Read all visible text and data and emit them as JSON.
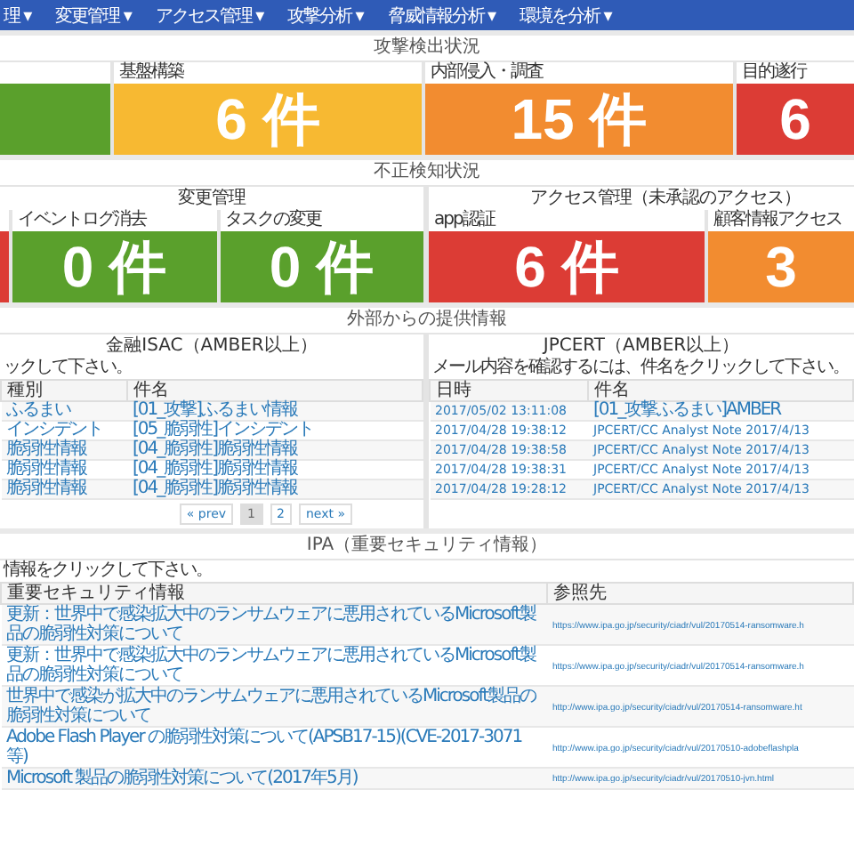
{
  "nav": [
    {
      "label": "理 ▾"
    },
    {
      "label": "変更管理 ▾"
    },
    {
      "label": "アクセス管理 ▾"
    },
    {
      "label": "攻撃分析 ▾"
    },
    {
      "label": "脅威情報分析 ▾"
    },
    {
      "label": "環境を分析 ▾"
    }
  ],
  "attack": {
    "title": "攻撃検出状況",
    "cards": [
      {
        "color": "#5aa02c"
      },
      {
        "label": "基盤構築",
        "value": "6 件",
        "color": "#f7b932"
      },
      {
        "label": "内部侵入・調査",
        "value": "15 件",
        "color": "#f28c30"
      },
      {
        "label": "目的遂行",
        "value": "6",
        "color": "#dc3c35"
      }
    ]
  },
  "fraud": {
    "title": "不正検知状況",
    "groups": [
      {
        "title": "変更管理",
        "cards": [
          {
            "color": "#dc3c35"
          },
          {
            "label": "イベントログ消去",
            "value": "0 件",
            "color": "#5aa02c"
          },
          {
            "label": "タスクの変更",
            "value": "0 件",
            "color": "#5aa02c"
          }
        ]
      },
      {
        "title": "アクセス管理（未承認のアクセス）",
        "cards": [
          {
            "label": "app認証",
            "value": "6 件",
            "color": "#dc3c35"
          },
          {
            "label": "顧客情報アクセス",
            "value": "3",
            "color": "#f28c30"
          }
        ]
      }
    ]
  },
  "external": {
    "title": "外部からの提供情報",
    "panels": [
      {
        "title": "金融ISAC（AMBER以上）",
        "instruction": "ックして下さい。",
        "columns": [
          "種別",
          "件名"
        ],
        "rows": [
          [
            "ふるまい",
            "[01_攻撃]ふるまい情報"
          ],
          [
            "インシデント",
            "[05_脆弱性]インシデント"
          ],
          [
            "脆弱性情報",
            "[04_脆弱性]脆弱性情報"
          ],
          [
            "脆弱性情報",
            "[04_脆弱性]脆弱性情報"
          ],
          [
            "脆弱性情報",
            "[04_脆弱性]脆弱性情報"
          ]
        ],
        "pager": [
          {
            "label": "« prev",
            "selected": false
          },
          {
            "label": "1",
            "selected": true
          },
          {
            "label": "2",
            "selected": false
          },
          {
            "label": "next »",
            "selected": false
          }
        ]
      },
      {
        "title": "JPCERT（AMBER以上）",
        "instruction": "メール内容を確認するには、件名をクリックして下さい。",
        "columns": [
          "日時",
          "件名"
        ],
        "rows": [
          [
            "2017/05/02 13:11:08",
            "[01_攻撃ふるまい]AMBER"
          ],
          [
            "2017/04/28 19:38:12",
            "JPCERT/CC Analyst Note 2017/4/13"
          ],
          [
            "2017/04/28 19:38:58",
            "JPCERT/CC Analyst Note 2017/4/13"
          ],
          [
            "2017/04/28 19:38:31",
            "JPCERT/CC Analyst Note 2017/4/13"
          ],
          [
            "2017/04/28 19:28:12",
            "JPCERT/CC Analyst Note 2017/4/13"
          ]
        ]
      }
    ]
  },
  "ipa": {
    "title": "IPA（重要セキュリティ情報）",
    "instruction": "情報をクリックして下さい。",
    "columns": [
      "重要セキュリティ情報",
      "参照先"
    ],
    "rows": [
      [
        "更新：世界中で感染拡大中のランサムウェアに悪用されているMicrosoft製品の脆弱性対策について",
        "https://www.ipa.go.jp/security/ciadr/vul/20170514-ransomware.h"
      ],
      [
        "更新：世界中で感染拡大中のランサムウェアに悪用されているMicrosoft製品の脆弱性対策について",
        "https://www.ipa.go.jp/security/ciadr/vul/20170514-ransomware.h"
      ],
      [
        "世界中で感染が拡大中のランサムウェアに悪用されているMicrosoft製品の脆弱性対策について",
        "http://www.ipa.go.jp/security/ciadr/vul/20170514-ransomware.ht"
      ],
      [
        "Adobe Flash Player の脆弱性対策について(APSB17-15)(CVE-2017-3071等)",
        "http://www.ipa.go.jp/security/ciadr/vul/20170510-adobeflashpla"
      ],
      [
        "Microsoft 製品の脆弱性対策について(2017年5月)",
        "http://www.ipa.go.jp/security/ciadr/vul/20170510-jvn.html"
      ]
    ]
  }
}
